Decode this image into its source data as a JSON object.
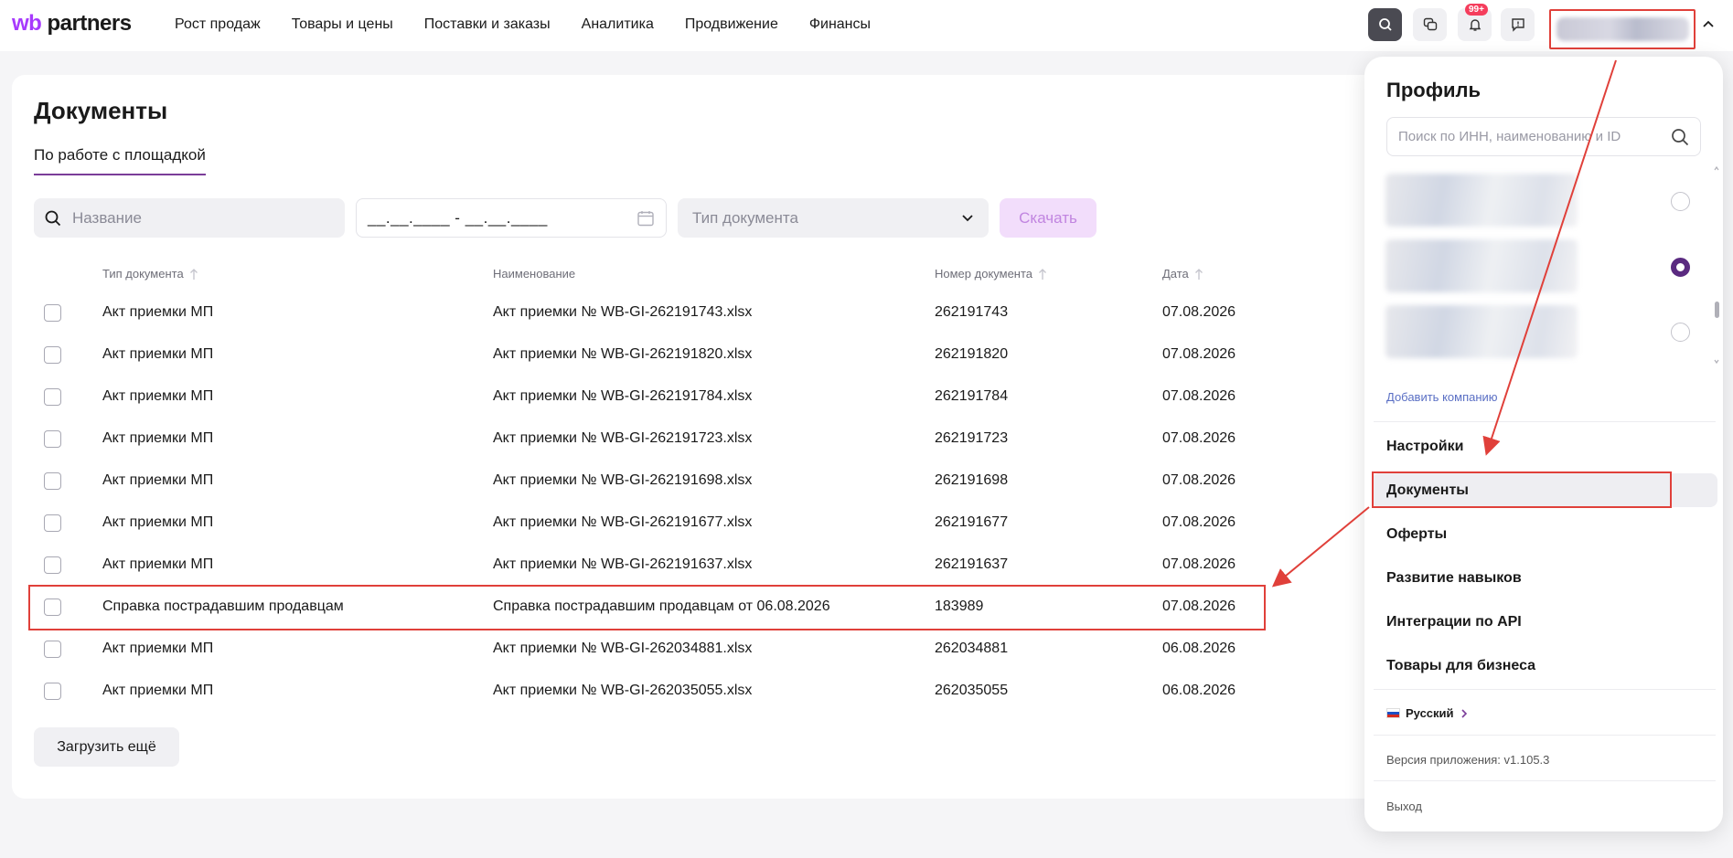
{
  "header": {
    "logo": "partners",
    "logo_prefix": "wb",
    "nav": [
      "Рост продаж",
      "Товары и цены",
      "Поставки и заказы",
      "Аналитика",
      "Продвижение",
      "Финансы"
    ],
    "notifications_badge": "99+",
    "icons": [
      "search-icon",
      "chat-icon",
      "bell-icon",
      "feedback-icon",
      "chevron-up-icon"
    ]
  },
  "page": {
    "title": "Документы",
    "tab": "По работе с площадкой"
  },
  "filters": {
    "search_placeholder": "Название",
    "date_value": "__.__.____ - __.__.____",
    "type_placeholder": "Тип документа",
    "download_label": "Скачать"
  },
  "table": {
    "headers": [
      "Тип документа",
      "Наименование",
      "Номер документа",
      "Дата"
    ],
    "rows": [
      {
        "type": "Акт приемки МП",
        "name": "Акт приемки № WB-GI-262191743.xlsx",
        "number": "262191743",
        "date": "07.08.2026"
      },
      {
        "type": "Акт приемки МП",
        "name": "Акт приемки № WB-GI-262191820.xlsx",
        "number": "262191820",
        "date": "07.08.2026"
      },
      {
        "type": "Акт приемки МП",
        "name": "Акт приемки № WB-GI-262191784.xlsx",
        "number": "262191784",
        "date": "07.08.2026"
      },
      {
        "type": "Акт приемки МП",
        "name": "Акт приемки № WB-GI-262191723.xlsx",
        "number": "262191723",
        "date": "07.08.2026"
      },
      {
        "type": "Акт приемки МП",
        "name": "Акт приемки № WB-GI-262191698.xlsx",
        "number": "262191698",
        "date": "07.08.2026"
      },
      {
        "type": "Акт приемки МП",
        "name": "Акт приемки № WB-GI-262191677.xlsx",
        "number": "262191677",
        "date": "07.08.2026"
      },
      {
        "type": "Акт приемки МП",
        "name": "Акт приемки № WB-GI-262191637.xlsx",
        "number": "262191637",
        "date": "07.08.2026"
      },
      {
        "type": "Справка пострадавшим продавцам",
        "name": "Справка пострадавшим продавцам от 06.08.2026",
        "number": "183989",
        "date": "07.08.2026"
      },
      {
        "type": "Акт приемки МП",
        "name": "Акт приемки № WB-GI-262034881.xlsx",
        "number": "262034881",
        "date": "06.08.2026"
      },
      {
        "type": "Акт приемки МП",
        "name": "Акт приемки № WB-GI-262035055.xlsx",
        "number": "262035055",
        "date": "06.08.2026"
      }
    ],
    "load_more": "Загрузить ещё"
  },
  "profile": {
    "title": "Профиль",
    "search_placeholder": "Поиск по ИНН, наименованию и ID",
    "add_company": "Добавить компанию",
    "menu": [
      "Настройки",
      "Документы",
      "Оферты",
      "Развитие навыков",
      "Интеграции по API",
      "Товары для бизнеса"
    ],
    "language": "Русский",
    "version": "Версия приложения: v1.105.3",
    "exit": "Выход"
  },
  "colors": {
    "accent": "#a73afd",
    "annotation": "#e0403a",
    "radio_selected": "#5a2a80"
  }
}
